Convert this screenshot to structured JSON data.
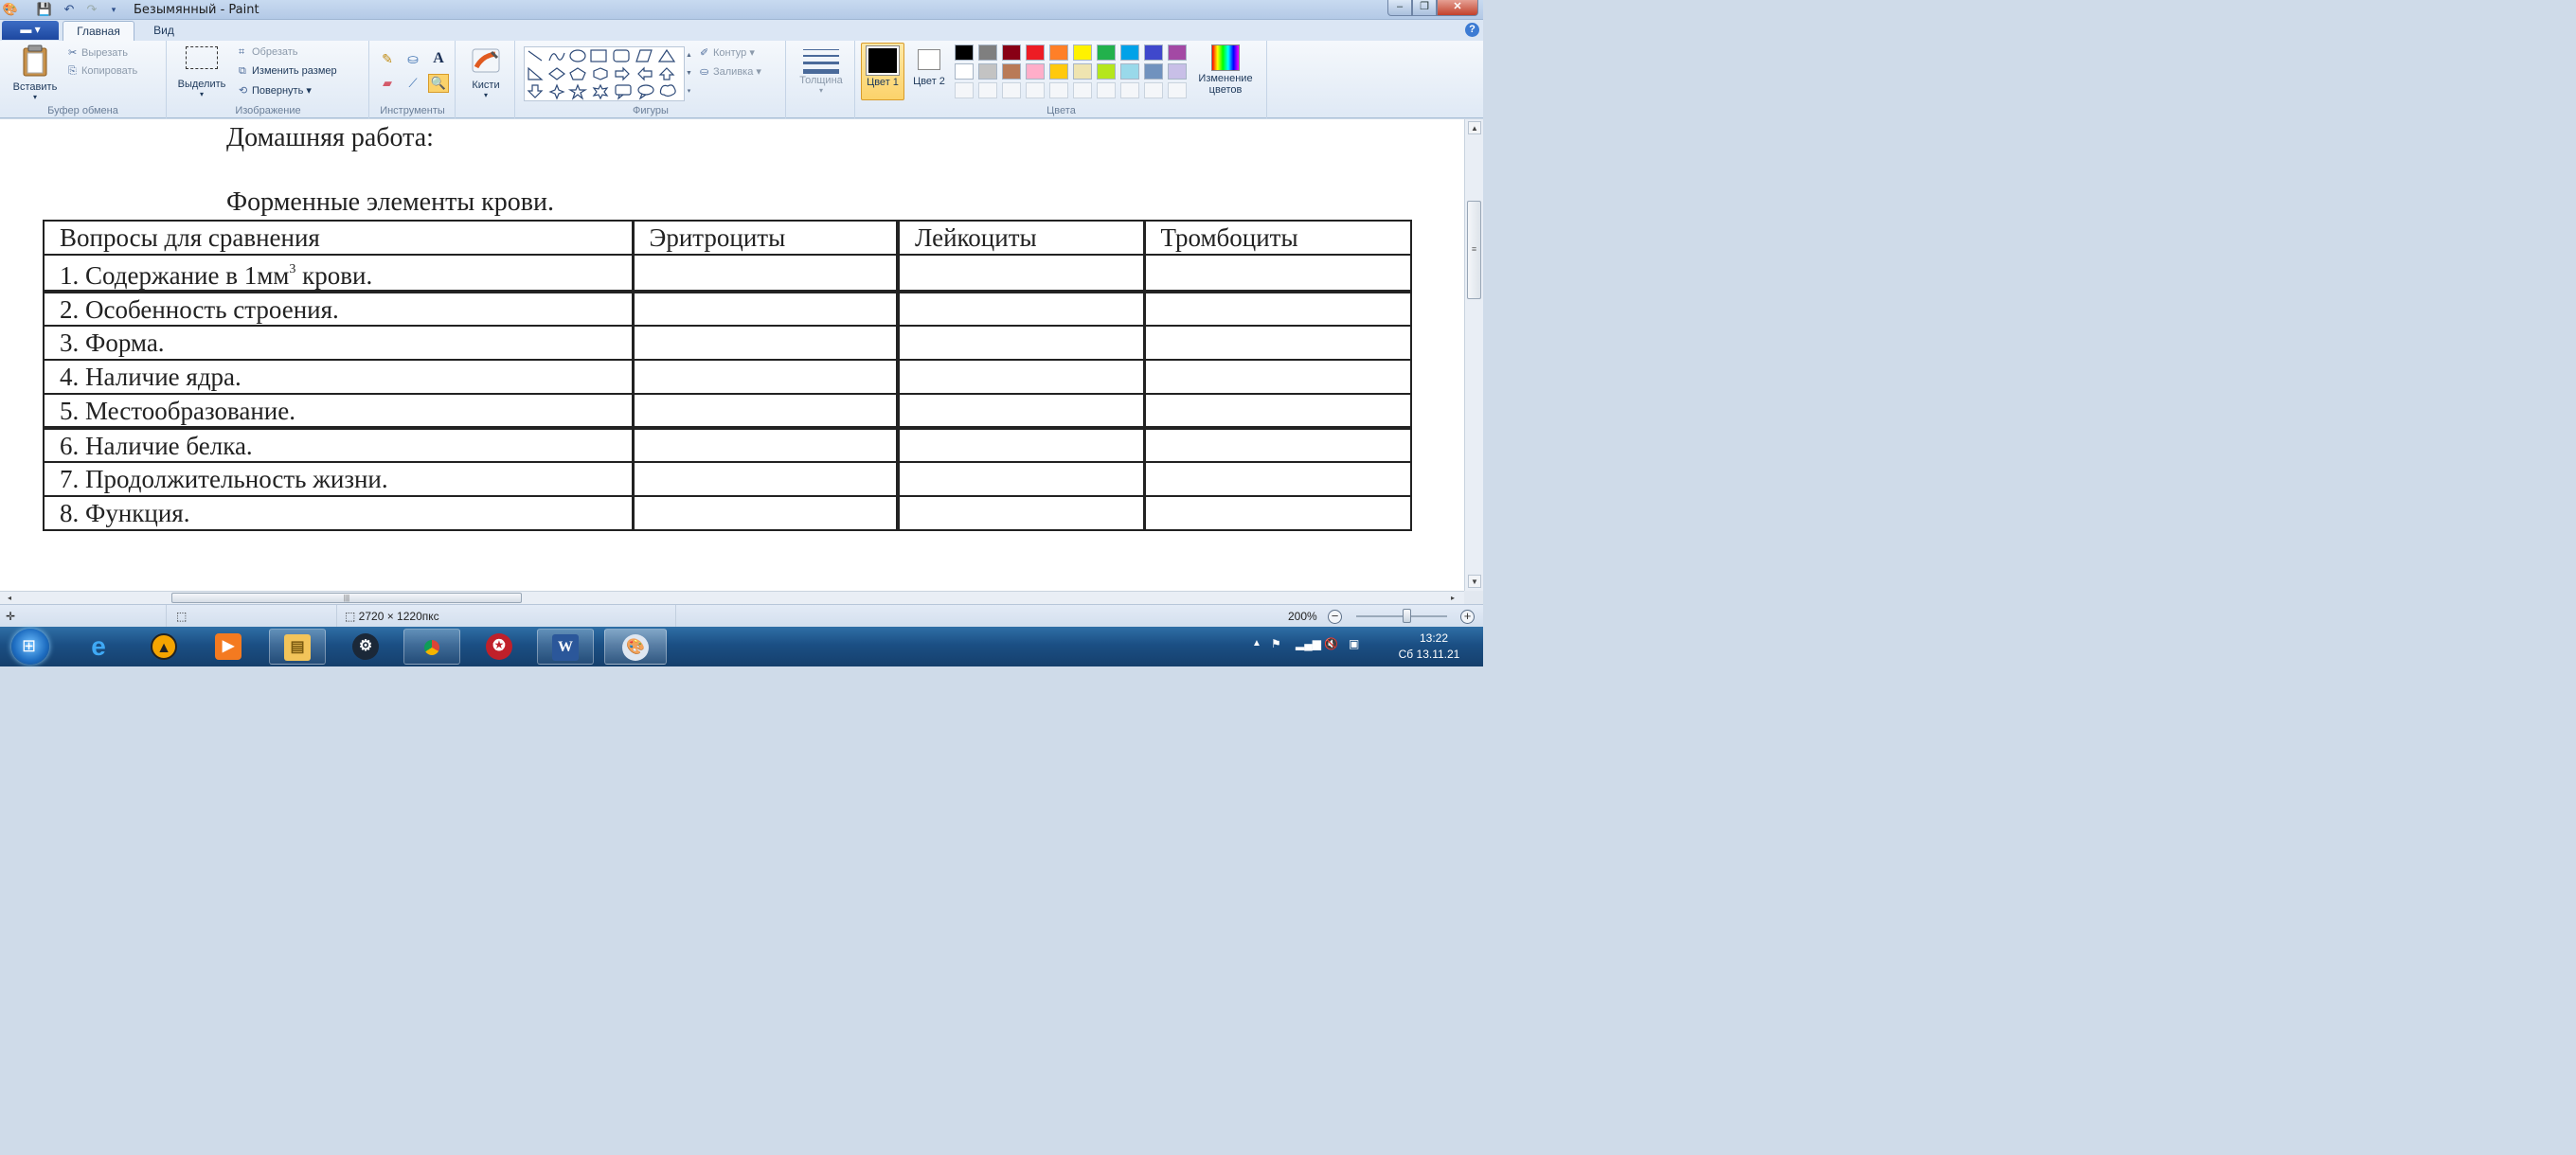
{
  "window": {
    "title": "Безымянный - Paint"
  },
  "tabs": {
    "home": "Главная",
    "view": "Вид"
  },
  "clipboard": {
    "paste": "Вставить",
    "cut": "Вырезать",
    "copy": "Копировать",
    "label": "Буфер обмена"
  },
  "image": {
    "select": "Выделить",
    "crop": "Обрезать",
    "resize": "Изменить размер",
    "rotate": "Повернуть",
    "label": "Изображение"
  },
  "tools": {
    "label": "Инструменты"
  },
  "brushes": {
    "label": "Кисти"
  },
  "shapes": {
    "outline": "Контур",
    "fill": "Заливка",
    "label": "Фигуры"
  },
  "size": {
    "label": "Толщина"
  },
  "colors": {
    "color1_label": "Цвет 1",
    "color2_label": "Цвет 2",
    "edit_colors": "Изменение цветов",
    "label": "Цвета",
    "color1": "#000000",
    "color2": "#ffffff",
    "palette": [
      "#000000",
      "#7f7f7f",
      "#880015",
      "#ed1c24",
      "#ff7f27",
      "#fff200",
      "#22b14c",
      "#00a2e8",
      "#3f48cc",
      "#a349a4",
      "#ffffff",
      "#c3c3c3",
      "#b97a57",
      "#ffaec9",
      "#ffc90e",
      "#efe4b0",
      "#b5e61d",
      "#99d9ea",
      "#7092be",
      "#c8bfe7"
    ]
  },
  "document": {
    "title": "Домашняя работа:",
    "subtitle": "Форменные элементы крови.",
    "headers": [
      "Вопросы для сравнения",
      "Эритроциты",
      "Лейкоциты",
      "Тромбоциты"
    ],
    "rows": [
      "1. Содержание в 1мм",
      "2. Особенность строения.",
      "3. Форма.",
      "4. Наличие ядра.",
      "5. Местообразование.",
      "6. Наличие белка.",
      "7. Продолжительность жизни.",
      "8. Функция."
    ],
    "row1_sup": "3",
    "row1_suffix": " крови."
  },
  "status": {
    "size": "2720 × 1220пкс",
    "zoom": "200%"
  },
  "taskbar": {
    "time": "13:22",
    "date": "Сб 13.11.21"
  }
}
